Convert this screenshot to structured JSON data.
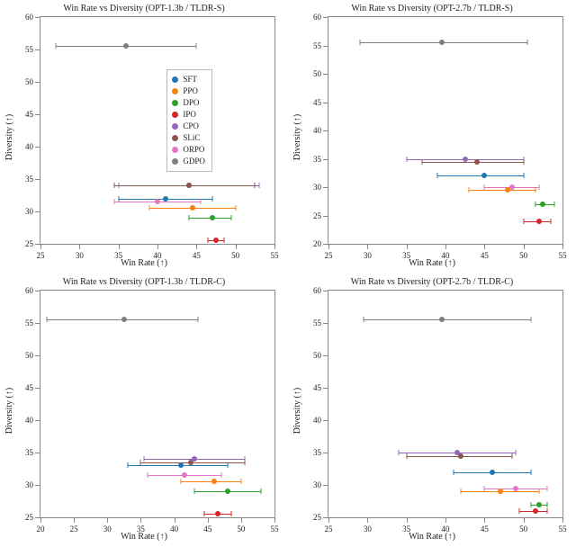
{
  "legend": [
    {
      "key": "SFT",
      "color": "#1f77b4"
    },
    {
      "key": "PPO",
      "color": "#ff7f0e"
    },
    {
      "key": "DPO",
      "color": "#2ca02c"
    },
    {
      "key": "IPO",
      "color": "#d62728"
    },
    {
      "key": "CPO",
      "color": "#9467bd"
    },
    {
      "key": "SLiC",
      "color": "#8c564b"
    },
    {
      "key": "ORPO",
      "color": "#e377c2"
    },
    {
      "key": "GDPO",
      "color": "#7f7f7f"
    }
  ],
  "chart_data": [
    {
      "type": "scatter",
      "title": "Win Rate vs Diversity (OPT-1.3b / TLDR-S)",
      "xlabel": "Win Rate (↑)",
      "ylabel": "Diversity (↑)",
      "xlim": [
        25,
        55
      ],
      "ylim": [
        25,
        60
      ],
      "xticks": [
        25,
        30,
        35,
        40,
        45,
        50,
        55
      ],
      "yticks": [
        25,
        30,
        35,
        40,
        45,
        50,
        55,
        60
      ],
      "legend_pos": {
        "left_pct": 54,
        "top_pct": 23
      },
      "points": {
        "SFT": {
          "x": 41.0,
          "y": 32.0,
          "xlo": 35.0,
          "xhi": 47.0
        },
        "PPO": {
          "x": 44.5,
          "y": 30.5,
          "xlo": 39.0,
          "xhi": 50.0
        },
        "DPO": {
          "x": 47.0,
          "y": 29.0,
          "xlo": 44.0,
          "xhi": 49.5
        },
        "IPO": {
          "x": 47.5,
          "y": 25.5,
          "xlo": 46.5,
          "xhi": 48.5
        },
        "CPO": {
          "x": 44.0,
          "y": 34.0,
          "xlo": 35.0,
          "xhi": 53.0
        },
        "SLiC": {
          "x": 44.0,
          "y": 34.0,
          "xlo": 34.5,
          "xhi": 52.5
        },
        "ORPO": {
          "x": 40.0,
          "y": 31.5,
          "xlo": 34.5,
          "xhi": 45.5
        },
        "GDPO": {
          "x": 36.0,
          "y": 55.5,
          "xlo": 27.0,
          "xhi": 45.0
        }
      }
    },
    {
      "type": "scatter",
      "title": "Win Rate vs Diversity (OPT-2.7b / TLDR-S)",
      "xlabel": "Win Rate (↑)",
      "ylabel": "Diversity (↑)",
      "xlim": [
        25,
        55
      ],
      "ylim": [
        20,
        60
      ],
      "xticks": [
        25,
        30,
        35,
        40,
        45,
        50,
        55
      ],
      "yticks": [
        20,
        25,
        30,
        35,
        40,
        45,
        50,
        55,
        60
      ],
      "points": {
        "SFT": {
          "x": 45.0,
          "y": 32.0,
          "xlo": 39.0,
          "xhi": 50.0
        },
        "PPO": {
          "x": 48.0,
          "y": 29.5,
          "xlo": 43.0,
          "xhi": 51.5
        },
        "DPO": {
          "x": 52.5,
          "y": 27.0,
          "xlo": 51.5,
          "xhi": 54.0
        },
        "IPO": {
          "x": 52.0,
          "y": 24.0,
          "xlo": 50.0,
          "xhi": 53.5
        },
        "CPO": {
          "x": 42.5,
          "y": 35.0,
          "xlo": 35.0,
          "xhi": 50.0
        },
        "SLiC": {
          "x": 44.0,
          "y": 34.5,
          "xlo": 37.0,
          "xhi": 50.0
        },
        "ORPO": {
          "x": 48.5,
          "y": 30.0,
          "xlo": 45.0,
          "xhi": 52.0
        },
        "GDPO": {
          "x": 39.5,
          "y": 55.5,
          "xlo": 29.0,
          "xhi": 50.5
        }
      }
    },
    {
      "type": "scatter",
      "title": "Win Rate vs Diversity (OPT-1.3b / TLDR-C)",
      "xlabel": "Win Rate (↑)",
      "ylabel": "Diversity (↑)",
      "xlim": [
        20,
        55
      ],
      "ylim": [
        25,
        60
      ],
      "xticks": [
        20,
        25,
        30,
        35,
        40,
        45,
        50,
        55
      ],
      "yticks": [
        25,
        30,
        35,
        40,
        45,
        50,
        55,
        60
      ],
      "points": {
        "SFT": {
          "x": 41.0,
          "y": 33.0,
          "xlo": 33.0,
          "xhi": 48.0
        },
        "PPO": {
          "x": 46.0,
          "y": 30.5,
          "xlo": 41.0,
          "xhi": 50.0
        },
        "DPO": {
          "x": 48.0,
          "y": 29.0,
          "xlo": 43.0,
          "xhi": 53.0
        },
        "IPO": {
          "x": 46.5,
          "y": 25.5,
          "xlo": 44.5,
          "xhi": 48.5
        },
        "CPO": {
          "x": 43.0,
          "y": 34.0,
          "xlo": 35.5,
          "xhi": 50.5
        },
        "SLiC": {
          "x": 42.5,
          "y": 33.5,
          "xlo": 35.0,
          "xhi": 50.5
        },
        "ORPO": {
          "x": 41.5,
          "y": 31.5,
          "xlo": 36.0,
          "xhi": 47.0
        },
        "GDPO": {
          "x": 32.5,
          "y": 55.5,
          "xlo": 21.0,
          "xhi": 43.5
        }
      }
    },
    {
      "type": "scatter",
      "title": "Win Rate vs Diversity (OPT-2.7b / TLDR-C)",
      "xlabel": "Win Rate (↑)",
      "ylabel": "Diversity (↑)",
      "xlim": [
        25,
        55
      ],
      "ylim": [
        25,
        60
      ],
      "xticks": [
        25,
        30,
        35,
        40,
        45,
        50,
        55
      ],
      "yticks": [
        25,
        30,
        35,
        40,
        45,
        50,
        55,
        60
      ],
      "points": {
        "SFT": {
          "x": 46.0,
          "y": 32.0,
          "xlo": 41.0,
          "xhi": 51.0
        },
        "PPO": {
          "x": 47.0,
          "y": 29.0,
          "xlo": 42.0,
          "xhi": 52.0
        },
        "DPO": {
          "x": 52.0,
          "y": 27.0,
          "xlo": 51.0,
          "xhi": 53.0
        },
        "IPO": {
          "x": 51.5,
          "y": 26.0,
          "xlo": 49.5,
          "xhi": 53.0
        },
        "CPO": {
          "x": 41.5,
          "y": 35.0,
          "xlo": 34.0,
          "xhi": 49.0
        },
        "SLiC": {
          "x": 42.0,
          "y": 34.5,
          "xlo": 35.0,
          "xhi": 48.5
        },
        "ORPO": {
          "x": 49.0,
          "y": 29.5,
          "xlo": 45.0,
          "xhi": 53.0
        },
        "GDPO": {
          "x": 39.5,
          "y": 55.5,
          "xlo": 29.5,
          "xhi": 51.0
        }
      }
    }
  ]
}
